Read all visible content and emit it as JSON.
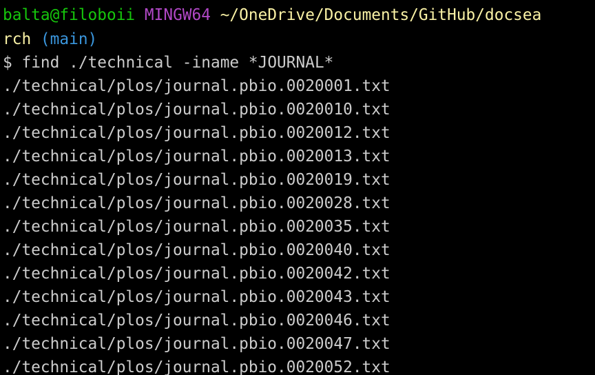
{
  "prompt": {
    "user_host": "balta@filoboii",
    "system": "MINGW64",
    "path_part1": "~/OneDrive/Documents/GitHub/docsea",
    "path_part2": "rch",
    "branch": "(main)",
    "symbol": "$",
    "command": "find ./technical -iname *JOURNAL*"
  },
  "output": [
    "./technical/plos/journal.pbio.0020001.txt",
    "./technical/plos/journal.pbio.0020010.txt",
    "./technical/plos/journal.pbio.0020012.txt",
    "./technical/plos/journal.pbio.0020013.txt",
    "./technical/plos/journal.pbio.0020019.txt",
    "./technical/plos/journal.pbio.0020028.txt",
    "./technical/plos/journal.pbio.0020035.txt",
    "./technical/plos/journal.pbio.0020040.txt",
    "./technical/plos/journal.pbio.0020042.txt",
    "./technical/plos/journal.pbio.0020043.txt",
    "./technical/plos/journal.pbio.0020046.txt",
    "./technical/plos/journal.pbio.0020047.txt",
    "./technical/plos/journal.pbio.0020052.txt"
  ],
  "colors": {
    "background": "#000000",
    "user_host": "#16c60c",
    "system": "#b148c6",
    "path": "#f9f1a5",
    "branch": "#3a96dd",
    "text": "#cccccc"
  }
}
